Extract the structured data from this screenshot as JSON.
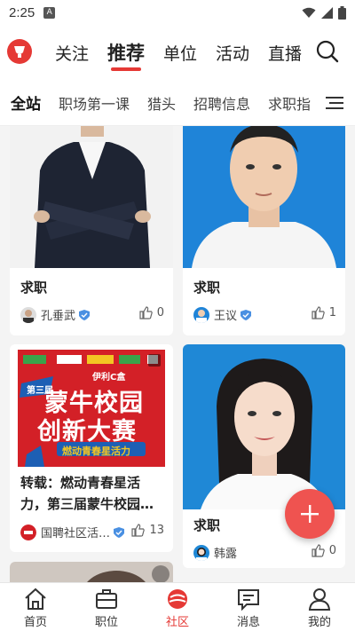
{
  "status_bar": {
    "time": "2:25",
    "notif_letter": "A"
  },
  "header": {
    "tabs": [
      {
        "label": "关注"
      },
      {
        "label": "推荐"
      },
      {
        "label": "单位"
      },
      {
        "label": "活动"
      },
      {
        "label": "直播"
      }
    ],
    "active_tab": "推荐"
  },
  "subtabs": {
    "items": [
      {
        "label": "全站"
      },
      {
        "label": "职场第一课"
      },
      {
        "label": "猎头"
      },
      {
        "label": "招聘信息"
      },
      {
        "label": "求职指"
      }
    ]
  },
  "feed": {
    "cards": [
      {
        "title": "求职",
        "author": "孔垂武",
        "likes": "0",
        "verified": true
      },
      {
        "title": "求职",
        "author": "王议",
        "likes": "1",
        "verified": true
      },
      {
        "title": "转载：燃动青春星活力，第三届蒙牛校园…",
        "author": "国聘社区活…",
        "likes": "13",
        "verified": true,
        "poster": {
          "line1": "蒙牛校园",
          "line2": "创新大赛",
          "line3": "燃动青春星活力",
          "badge": "第三届",
          "tag": "伊利C盒"
        }
      },
      {
        "title": "求职",
        "author": "韩露",
        "likes": "0",
        "verified": false
      }
    ]
  },
  "bottom_nav": {
    "items": [
      {
        "label": "首页"
      },
      {
        "label": "职位"
      },
      {
        "label": "社区"
      },
      {
        "label": "消息"
      },
      {
        "label": "我的"
      }
    ],
    "active": "社区"
  },
  "colors": {
    "accent": "#e53935",
    "fab": "#ef5350"
  }
}
